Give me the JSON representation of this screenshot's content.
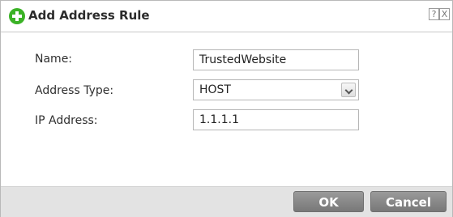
{
  "dialog": {
    "title": "Add Address Rule",
    "title_icon": "plus-circle-icon",
    "help_label": "?",
    "close_label": "X"
  },
  "form": {
    "name_label": "Name:",
    "name_value": "TrustedWebsite",
    "address_type_label": "Address Type:",
    "address_type_value": "HOST",
    "ip_address_label": "IP Address:",
    "ip_address_value": "1.1.1.1"
  },
  "footer": {
    "ok_label": "OK",
    "cancel_label": "Cancel"
  },
  "colors": {
    "accent_green": "#3bb226",
    "button_gray": "#888888",
    "footer_bg": "#e3e3e3"
  }
}
